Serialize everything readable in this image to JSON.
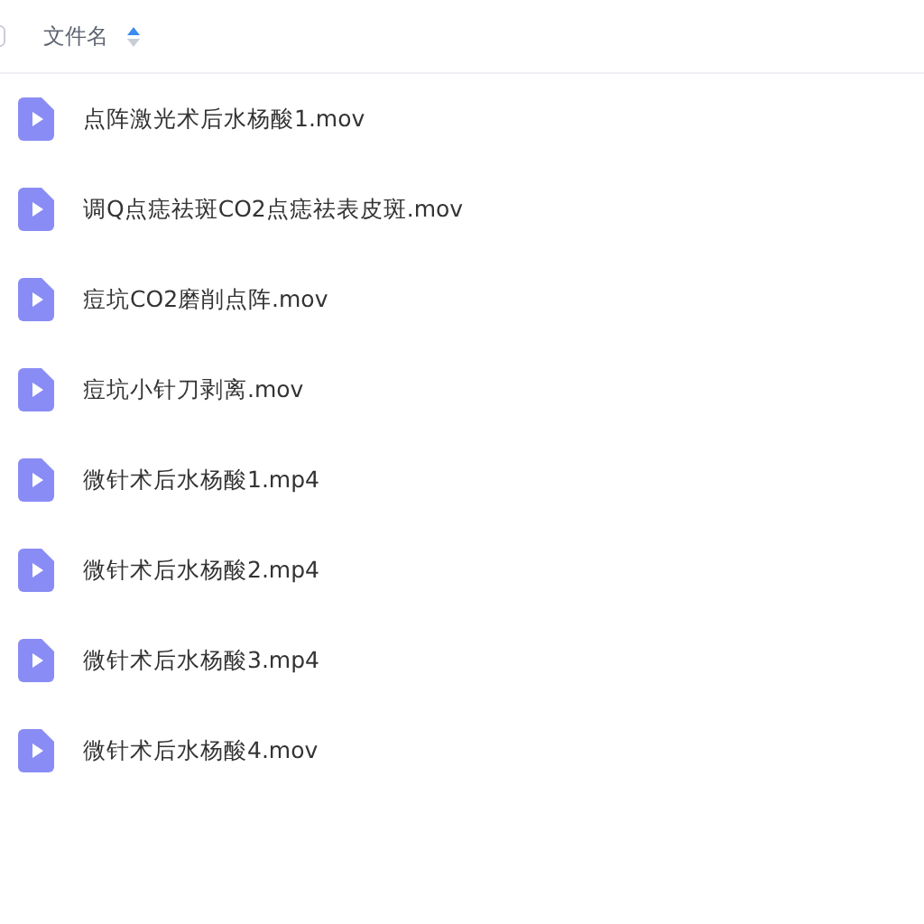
{
  "header": {
    "checked": false,
    "column_label": "文件名",
    "sorted_ascending": true
  },
  "files": [
    {
      "name": "点阵激光术后水杨酸1.mov"
    },
    {
      "name": "调Q点痣祛斑CO2点痣祛表皮斑.mov"
    },
    {
      "name": "痘坑CO2磨削点阵.mov"
    },
    {
      "name": "痘坑小针刀剥离.mov"
    },
    {
      "name": "微针术后水杨酸1.mp4"
    },
    {
      "name": "微针术后水杨酸2.mp4"
    },
    {
      "name": "微针术后水杨酸3.mp4"
    },
    {
      "name": "微针术后水杨酸4.mov"
    }
  ]
}
